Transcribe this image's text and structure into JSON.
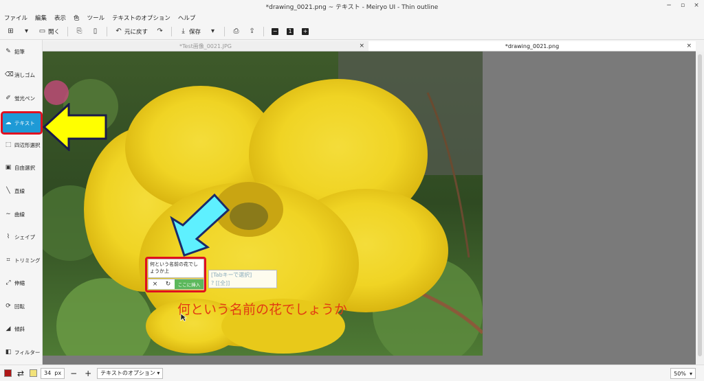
{
  "window": {
    "title": "*drawing_0021.png ~ テキスト - Meiryo UI - Thin outline",
    "controls": [
      "−",
      "▫",
      "×"
    ]
  },
  "menu": [
    "ファイル",
    "編集",
    "表示",
    "色",
    "ツール",
    "テキストのオプション",
    "ヘルプ"
  ],
  "toolbar": {
    "open": "開く",
    "undo": "元に戻す",
    "save": "保存"
  },
  "tools": [
    {
      "label": "鉛筆",
      "icon": "pencil-icon",
      "glyph": "✎"
    },
    {
      "label": "消しゴム",
      "icon": "eraser-icon",
      "glyph": "⌫"
    },
    {
      "label": "蛍光ペン",
      "icon": "highlighter-icon",
      "glyph": "✐"
    },
    {
      "label": "テキスト",
      "icon": "text-tool-icon",
      "glyph": "☁"
    },
    {
      "label": "四辺形選択",
      "icon": "rect-select-icon",
      "glyph": "⬚"
    },
    {
      "label": "自由選択",
      "icon": "free-select-icon",
      "glyph": "▣"
    },
    {
      "label": "直線",
      "icon": "line-icon",
      "glyph": "╲"
    },
    {
      "label": "曲線",
      "icon": "curve-icon",
      "glyph": "∼"
    },
    {
      "label": "シェイプ",
      "icon": "shape-icon",
      "glyph": "⌇"
    },
    {
      "label": "トリミング",
      "icon": "crop-icon",
      "glyph": "⌗"
    },
    {
      "label": "伸縮",
      "icon": "scale-icon",
      "glyph": "⤢"
    },
    {
      "label": "回転",
      "icon": "rotate-icon",
      "glyph": "⟳"
    },
    {
      "label": "傾斜",
      "icon": "skew-icon",
      "glyph": "◢"
    },
    {
      "label": "フィルター",
      "icon": "filter-icon",
      "glyph": "◧"
    }
  ],
  "active_tool": "テキスト",
  "tabs": [
    {
      "label": "*Test画像_0021.JPG",
      "active": false
    },
    {
      "label": "*drawing_0021.png",
      "active": true
    }
  ],
  "popup": {
    "input_value": "何という名前の花でしょうか上",
    "insert_label": "ここに挿入",
    "hint_line1": "[Tabキーで選択]",
    "hint_line2": "? [[全]]"
  },
  "canvas_text": "何という名前の花でしょうか",
  "statusbar": {
    "size_value": "34",
    "size_unit": "px",
    "text_options": "テキストのオプション",
    "zoom": "50%"
  },
  "colors": {
    "primary": "#b01818",
    "secondary": "#f2e27a",
    "accent": "#1e9ad6",
    "highlight": "#e01020",
    "text_color": "#e23a12"
  }
}
